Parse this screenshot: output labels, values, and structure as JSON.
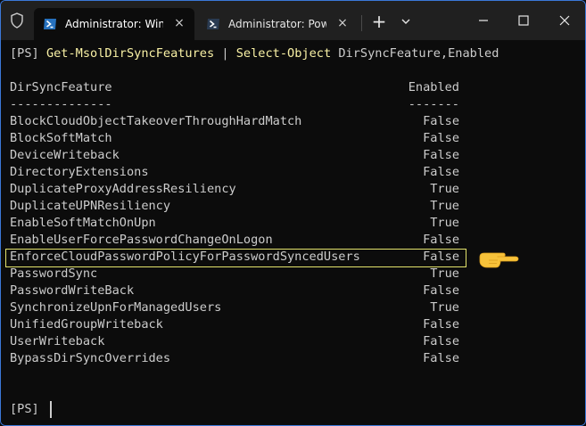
{
  "titlebar": {
    "tabs": [
      {
        "label": "Administrator: Windows PowerShell",
        "active": true
      },
      {
        "label": "Administrator: PowerShell",
        "active": false
      }
    ],
    "new_tab_symbol": "+",
    "close_symbol": "×"
  },
  "terminal": {
    "command": {
      "prompt": "[PS]",
      "cmdlet1": "Get-MsolDirSyncFeatures",
      "pipe": "|",
      "cmdlet2": "Select-Object",
      "args": "DirSyncFeature,Enabled"
    },
    "headers": {
      "feature": "DirSyncFeature",
      "enabled": "Enabled",
      "feature_rule": "--------------",
      "enabled_rule": "-------"
    },
    "rows": [
      {
        "feature": "BlockCloudObjectTakeoverThroughHardMatch",
        "enabled": "False"
      },
      {
        "feature": "BlockSoftMatch",
        "enabled": "False"
      },
      {
        "feature": "DeviceWriteback",
        "enabled": "False"
      },
      {
        "feature": "DirectoryExtensions",
        "enabled": "False"
      },
      {
        "feature": "DuplicateProxyAddressResiliency",
        "enabled": "True"
      },
      {
        "feature": "DuplicateUPNResiliency",
        "enabled": "True"
      },
      {
        "feature": "EnableSoftMatchOnUpn",
        "enabled": "True"
      },
      {
        "feature": "EnableUserForcePasswordChangeOnLogon",
        "enabled": "False"
      },
      {
        "feature": "EnforceCloudPasswordPolicyForPasswordSyncedUsers",
        "enabled": "False"
      },
      {
        "feature": "PasswordSync",
        "enabled": "True"
      },
      {
        "feature": "PasswordWriteBack",
        "enabled": "False"
      },
      {
        "feature": "SynchronizeUpnForManagedUsers",
        "enabled": "True"
      },
      {
        "feature": "UnifiedGroupWriteback",
        "enabled": "False"
      },
      {
        "feature": "UserWriteback",
        "enabled": "False"
      },
      {
        "feature": "BypassDirSyncOverrides",
        "enabled": "False"
      }
    ],
    "highlighted_row": "EnforceCloudPasswordPolicyForPasswordSyncedUsers",
    "final_prompt": "[PS]"
  },
  "colors": {
    "background": "#0c0c0c",
    "titlebar": "#202020",
    "text": "#cccccc",
    "cmdlet": "#f9f1a5",
    "highlight_border": "#e3e36c",
    "window_border": "#3b78d8",
    "pointer": "#f7c23a"
  },
  "icons": [
    "shield-icon",
    "powershell-icon",
    "close-icon",
    "plus-icon",
    "chevron-down-icon",
    "minimize-icon",
    "maximize-icon",
    "window-close-icon",
    "pointing-hand-icon"
  ]
}
